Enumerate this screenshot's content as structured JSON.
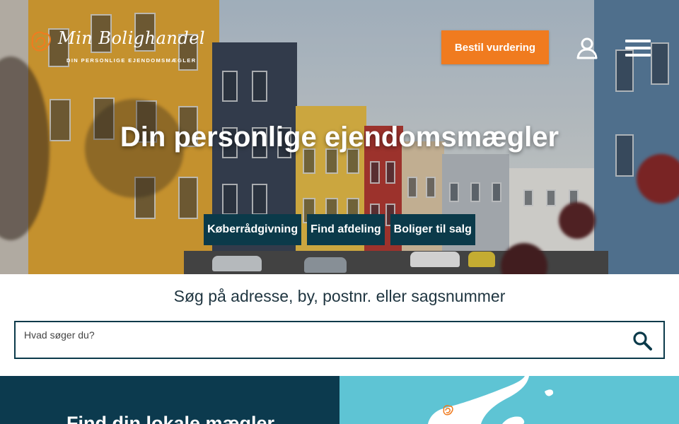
{
  "header": {
    "logo_script": "Min Bolighandel",
    "logo_tagline": "DIN PERSONLIGE EJENDOMSMÆGLER",
    "cta_label": "Bestil vurdering",
    "user_icon": "user-icon",
    "menu_icon": "hamburger-menu-icon"
  },
  "hero": {
    "title": "Din personlige ejendomsmægler",
    "links": [
      {
        "label": "Køberrådgivning"
      },
      {
        "label": "Find afdeling"
      },
      {
        "label": "Boliger til salg"
      }
    ]
  },
  "search": {
    "heading": "Søg på adresse, by, postnr. eller sagsnummer",
    "placeholder": "Hvad søger du?",
    "value": "",
    "icon": "search-icon"
  },
  "local_agent": {
    "title": "Find din lokale mægler"
  },
  "colors": {
    "accent": "#f07b1f",
    "dark_teal": "#0c3a4e",
    "map_water": "#5ec4d4"
  }
}
